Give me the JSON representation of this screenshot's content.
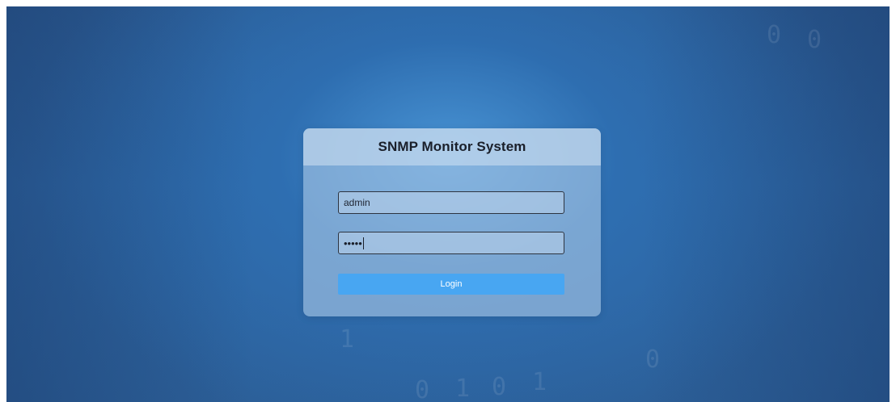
{
  "login": {
    "title": "SNMP Monitor System",
    "username_value": "admin",
    "password_mask": "•••••",
    "login_button_label": "Login"
  },
  "colors": {
    "background_center": "#4a96d7",
    "background_edge": "#2b5b93",
    "button": "#48a6f2",
    "card": "#aac8e6"
  }
}
